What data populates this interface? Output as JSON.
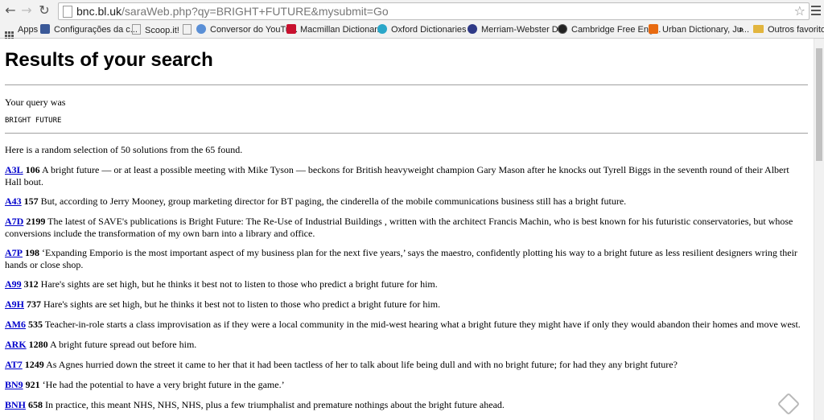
{
  "browser": {
    "url": {
      "host": "bnc.bl.uk",
      "path": "/saraWeb.php?qy=BRIGHT+FUTURE&mysubmit=Go"
    },
    "bookmarks": [
      {
        "label": "Apps",
        "icon": "apps-grid-icon"
      },
      {
        "label": "Configurações da c...",
        "icon": "facebook-icon",
        "color": "#3b5998"
      },
      {
        "label": "Scoop.it!",
        "icon": "page-icon"
      },
      {
        "label": "",
        "icon": "page-icon"
      },
      {
        "label": "Conversor do YouTu...",
        "icon": "youtube-converter-icon"
      },
      {
        "label": "Macmillan Dictionar...",
        "icon": "macmillan-icon",
        "color": "#c8102e"
      },
      {
        "label": "Oxford Dictionaries ...",
        "icon": "oxford-icon",
        "color": "#2aa7c9"
      },
      {
        "label": "Merriam-Webster D...",
        "icon": "merriam-webster-icon",
        "color": "#2f3a87"
      },
      {
        "label": "Cambridge Free Eng...",
        "icon": "cambridge-icon"
      },
      {
        "label": "Urban Dictionary, Ju...",
        "icon": "urban-dictionary-icon",
        "color": "#e86a10"
      },
      {
        "label": "»",
        "icon": ""
      },
      {
        "label": "Outros favoritos",
        "icon": "folder-icon"
      }
    ]
  },
  "page": {
    "title": "Results of your search",
    "query_label": "Your query was",
    "query": "BRIGHT FUTURE",
    "summary": "Here is a random selection of 50 solutions from the 65 found.",
    "results": [
      {
        "code": "A3L",
        "num": "106",
        "text": "A bright future — or at least a possible meeting with Mike Tyson — beckons for British heavyweight champion Gary Mason after he knocks out Tyrell Biggs in the seventh round of their Albert Hall bout."
      },
      {
        "code": "A43",
        "num": "157",
        "text": "But, according to Jerry Mooney, group marketing director for BT paging, the cinderella of the mobile communications business still has a bright future."
      },
      {
        "code": "A7D",
        "num": "2199",
        "text": "The latest of SAVE's publications is Bright Future: The Re-Use of Industrial Buildings , written with the architect Francis Machin, who is best known for his futuristic conservatories, but whose conversions include the transformation of my own barn into a library and office."
      },
      {
        "code": "A7P",
        "num": "198",
        "text": "‘Expanding Emporio is the most important aspect of my business plan for the next five years,’ says the maestro, confidently plotting his way to a bright future as less resilient designers wring their hands or close shop."
      },
      {
        "code": "A99",
        "num": "312",
        "text": "Hare's sights are set high, but he thinks it best not to listen to those who predict a bright future for him."
      },
      {
        "code": "A9H",
        "num": "737",
        "text": "Hare's sights are set high, but he thinks it best not to listen to those who predict a bright future for him."
      },
      {
        "code": "AM6",
        "num": "535",
        "text": "Teacher-in-role starts a class improvisation as if they were a local community in the mid-west hearing what a bright future they might have if only they would abandon their homes and move west."
      },
      {
        "code": "ARK",
        "num": "1280",
        "text": "A bright future spread out before him."
      },
      {
        "code": "AT7",
        "num": "1249",
        "text": "As Agnes hurried down the street it came to her that it had been tactless of her to talk about life being dull and with no bright future; for had they any bright future?"
      },
      {
        "code": "BN9",
        "num": "921",
        "text": "‘He had the potential to have a very bright future in the game.’"
      },
      {
        "code": "BNH",
        "num": "658",
        "text": "In practice, this meant NHS, NHS, NHS, plus a few triumphalist and premature nothings about the bright future ahead."
      }
    ]
  }
}
